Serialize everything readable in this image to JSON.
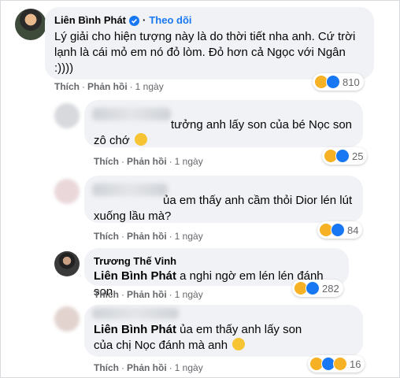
{
  "comments": [
    {
      "author": "Liên Bình Phát",
      "follow_label": "Theo dõi",
      "text": "Lý giải cho hiện tượng này là do thời tiết nha anh. Cứ trời lạnh là cái mỏ em nó đỏ lòm. Đỏ hơn cả Ngọc với Ngân :))))",
      "like_label": "Thích",
      "reply_label": "Phản hồi",
      "time": "1 ngày",
      "reaction_count": "810"
    },
    {
      "text": "tưởng anh lấy son của bé Nọc son zô chớ",
      "like_label": "Thích",
      "reply_label": "Phản hồi",
      "time": "1 ngày",
      "reaction_count": "25"
    },
    {
      "text": "ủa em thấy anh cầm thỏi Dior lén lút xuống lầu mà?",
      "like_label": "Thích",
      "reply_label": "Phản hồi",
      "time": "1 ngày",
      "reaction_count": "84"
    },
    {
      "author": "Trương Thế Vinh",
      "mention": "Liên Bình Phát",
      "text": "a nghi ngờ em lén lén đánh son",
      "like_label": "Thích",
      "reply_label": "Phản hồi",
      "time": "1 ngày",
      "reaction_count": "282"
    },
    {
      "mention": "Liên Bình Phát",
      "text": "ủa em thấy anh lấy son của chị Nọc đánh mà anh",
      "like_label": "Thích",
      "reply_label": "Phản hồi",
      "time": "1 ngày",
      "reaction_count": "16"
    }
  ],
  "colors": {
    "accent": "#1877f2",
    "bubble": "#f0f2f5",
    "meta_text": "#65676b",
    "haha": "#f7b125"
  },
  "icons": [
    "verified-badge-icon",
    "haha-reaction-icon",
    "like-reaction-icon",
    "sad-reaction-icon",
    "grinning-emoji-icon",
    "rofl-emoji-icon"
  ]
}
